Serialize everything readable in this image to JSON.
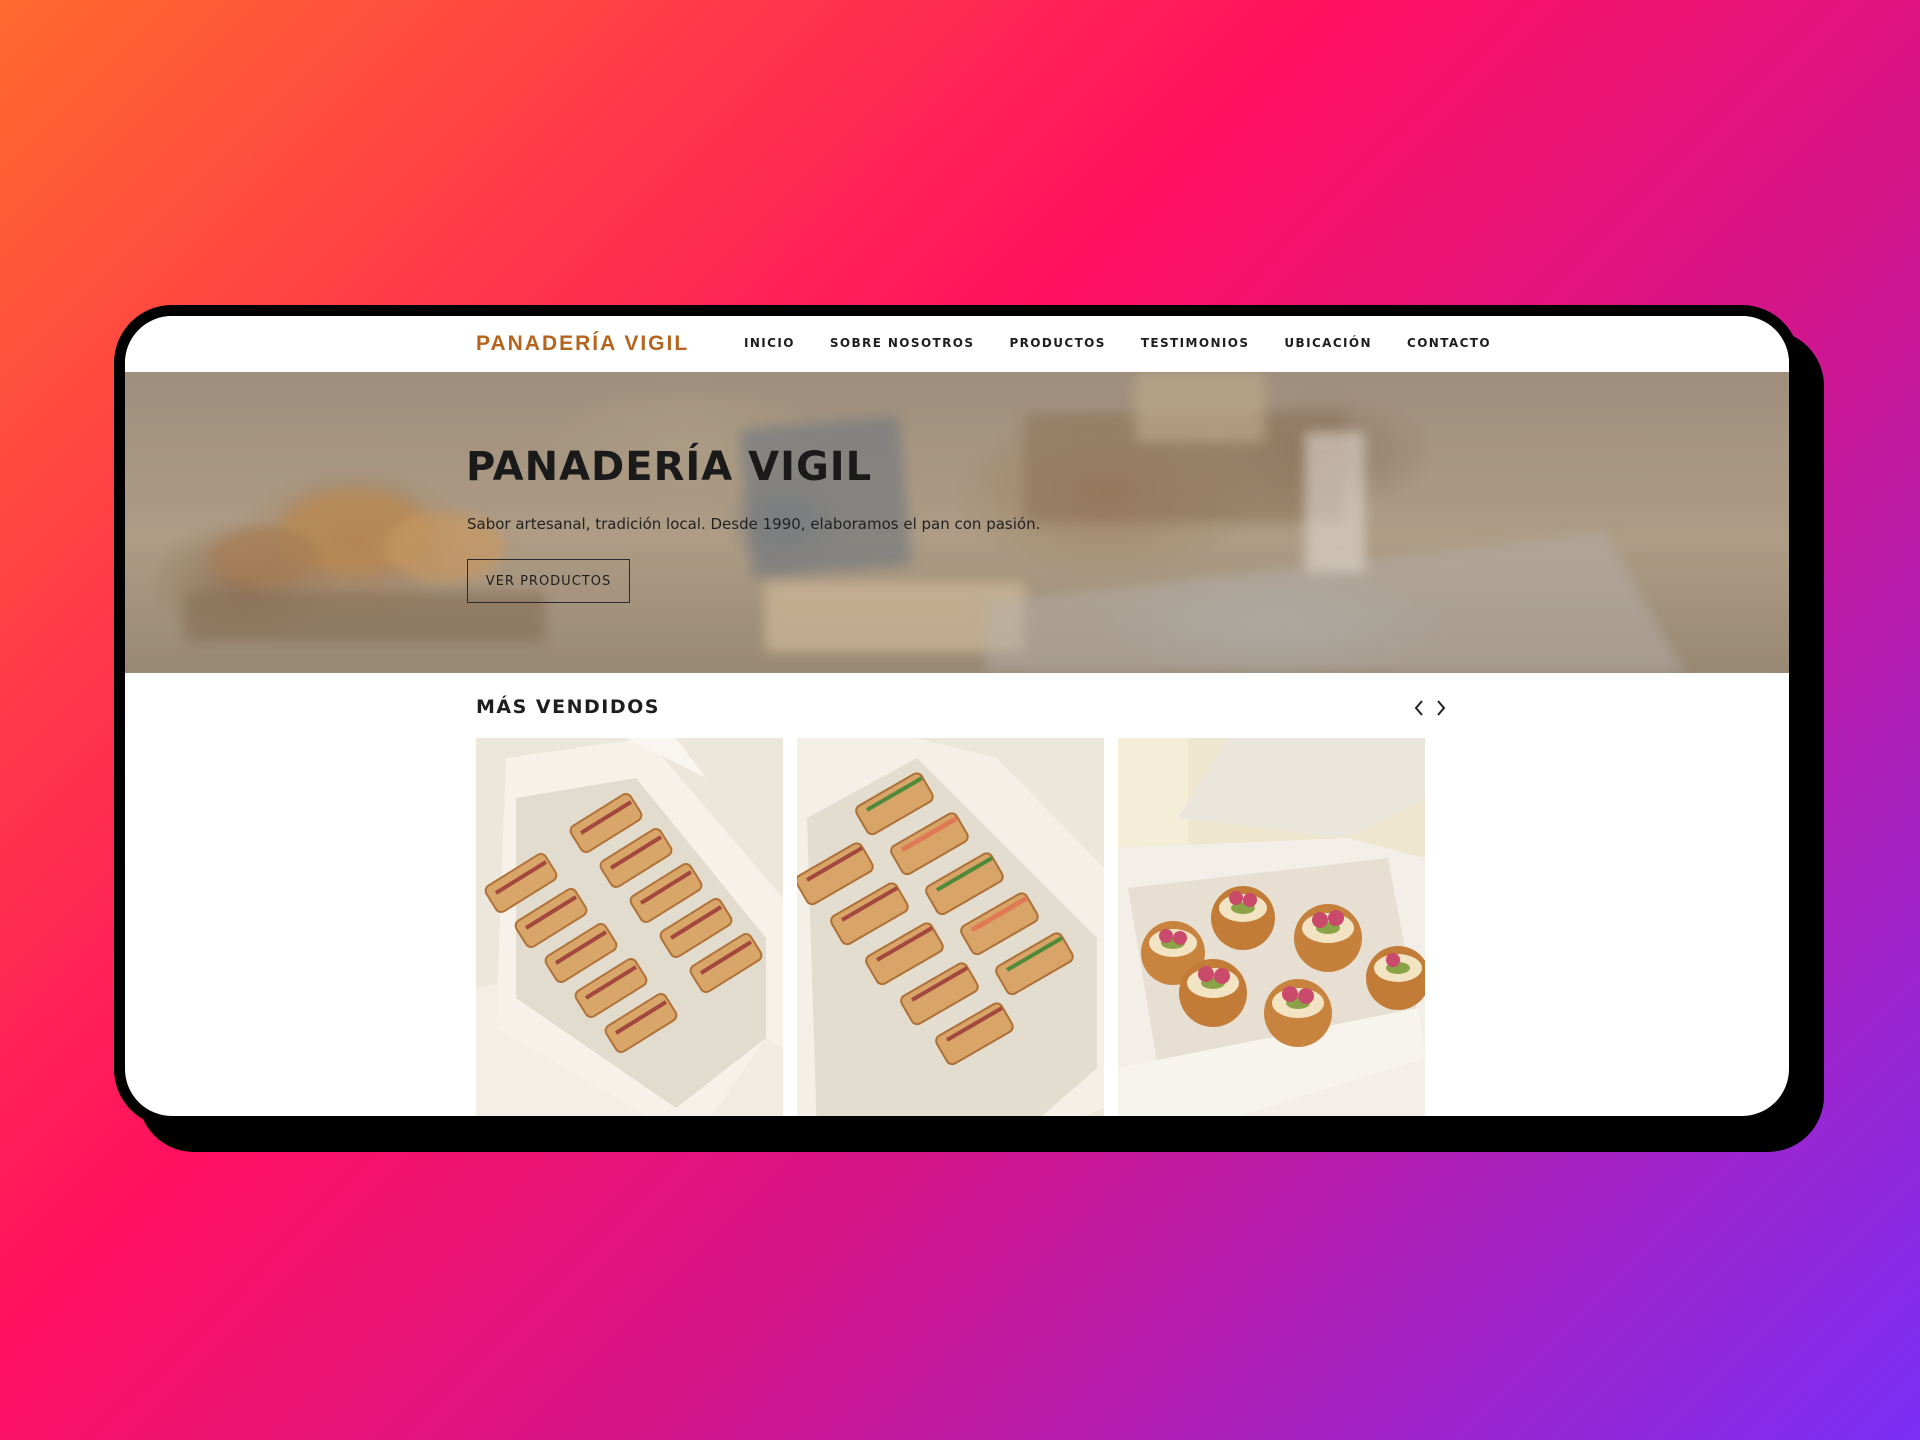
{
  "nav": {
    "brand": "PANADERÍA VIGIL",
    "links": [
      "INICIO",
      "SOBRE NOSOTROS",
      "PRODUCTOS",
      "TESTIMONIOS",
      "UBICACIÓN",
      "CONTACTO"
    ]
  },
  "hero": {
    "title": "PANADERÍA VIGIL",
    "subtitle": "Sabor artesanal, tradición local. Desde 1990, elaboramos el pan con pasión.",
    "button": "VER PRODUCTOS"
  },
  "bestsellers": {
    "title": "MÁS VENDIDOS",
    "prev_icon": "chevron-left-icon",
    "next_icon": "chevron-right-icon",
    "items": [
      {
        "image": "sandwich-box-photo"
      },
      {
        "image": "sandwich-box-photo"
      },
      {
        "image": "raspberry-donut-box-photo"
      }
    ]
  },
  "colors": {
    "brand": "#b5651d",
    "background_gradient": [
      "#ff6a2e",
      "#ff1060",
      "#7b2ff7"
    ]
  }
}
